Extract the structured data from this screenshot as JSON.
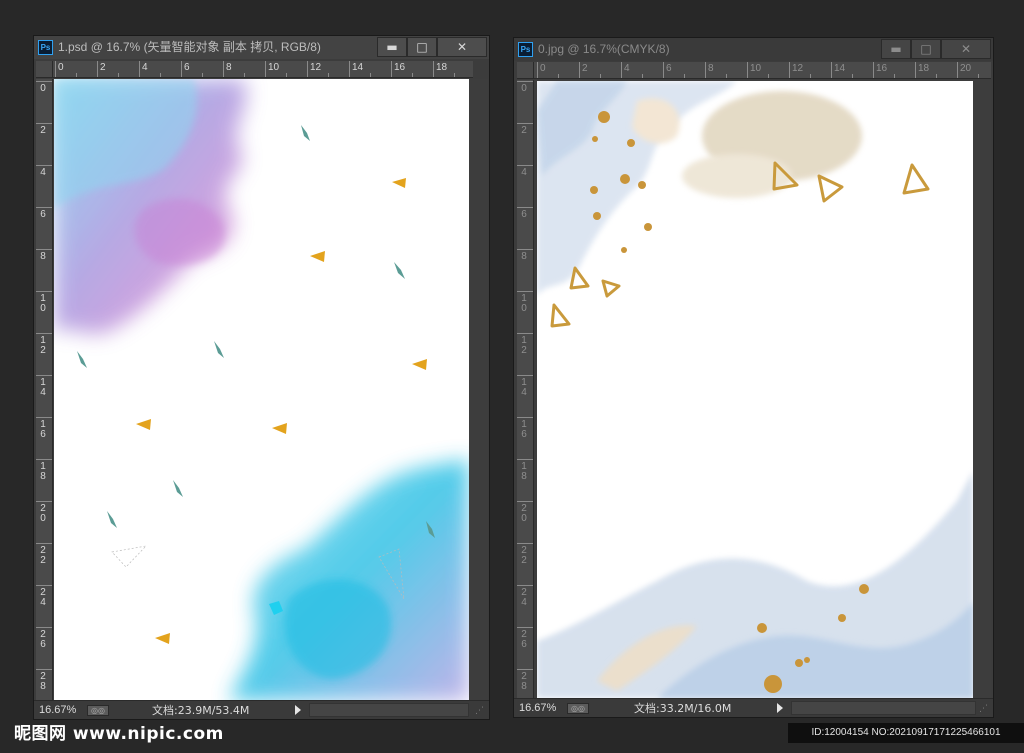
{
  "windows": [
    {
      "title": "1.psd @ 16.7% (矢量智能对象 副本 拷贝, RGB/8)",
      "app_icon": "Ps",
      "active": true,
      "buttons": {
        "minimize": "▬",
        "maximize": "□",
        "close": "✕"
      },
      "ruler_h": [
        "0",
        "2",
        "4",
        "6",
        "8",
        "10",
        "12",
        "14",
        "16",
        "18"
      ],
      "ruler_v": [
        "0",
        "2",
        "4",
        "6",
        "8",
        "1 0",
        "1 2",
        "1 4",
        "1 6",
        "1 8",
        "2 0",
        "2 2",
        "2 4",
        "2 6",
        "2 8"
      ],
      "status": {
        "zoom": "16.67%",
        "doc_info": "文档:23.9M/53.4M"
      }
    },
    {
      "title": "0.jpg @ 16.7%(CMYK/8)",
      "app_icon": "Ps",
      "active": false,
      "buttons": {
        "minimize": "▬",
        "maximize": "□",
        "close": "✕"
      },
      "ruler_h": [
        "0",
        "2",
        "4",
        "6",
        "8",
        "10",
        "12",
        "14",
        "16",
        "18",
        "20"
      ],
      "ruler_v": [
        "0",
        "2",
        "4",
        "6",
        "8",
        "1 0",
        "1 2",
        "1 4",
        "1 6",
        "1 8",
        "2 0",
        "2 2",
        "2 4",
        "2 6",
        "2 8"
      ],
      "status": {
        "zoom": "16.67%",
        "doc_info": "文档:33.2M/16.0M"
      }
    }
  ],
  "watermark": {
    "site": "昵图网 www.nipic.com",
    "id_text": "ID:12004154 NO:20210917171225466101"
  },
  "colors": {
    "panel_bg": "#282828",
    "accent_orange": "#e3a31d",
    "teal_shard": "#5b9c95",
    "gold": "#c99a3c",
    "watercolor_blue": "#35c6e6",
    "watercolor_purple": "#c98bd6"
  }
}
